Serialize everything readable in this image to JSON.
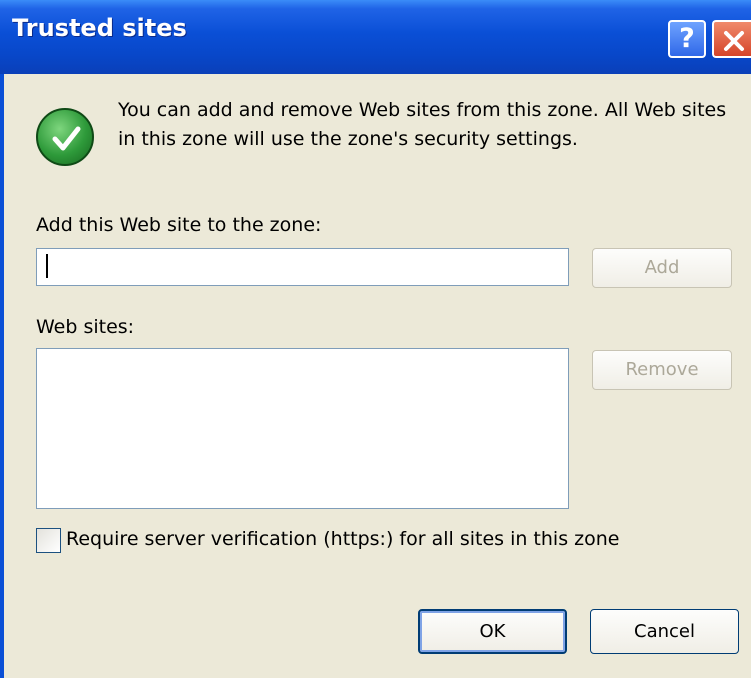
{
  "window": {
    "title": "Trusted sites",
    "help_label": "?",
    "close_icon": "close-icon"
  },
  "info": {
    "icon": "checkmark-shield-icon",
    "text": "You can add and remove Web sites from this zone. All Web sites in this zone will use the zone's security settings."
  },
  "add_site": {
    "label": "Add this Web site to the zone:",
    "value": "",
    "placeholder": "",
    "button_label": "Add"
  },
  "web_sites": {
    "label": "Web sites:",
    "items": [],
    "remove_label": "Remove"
  },
  "verification": {
    "label": "Require server verification (https:) for all sites in this zone",
    "checked": false
  },
  "footer": {
    "ok_label": "OK",
    "cancel_label": "Cancel"
  },
  "colors": {
    "titlebar": "#0a4fd6",
    "dialog_bg": "#ece9d8",
    "close_red": "#d5452a",
    "check_green": "#2e9a3a"
  }
}
